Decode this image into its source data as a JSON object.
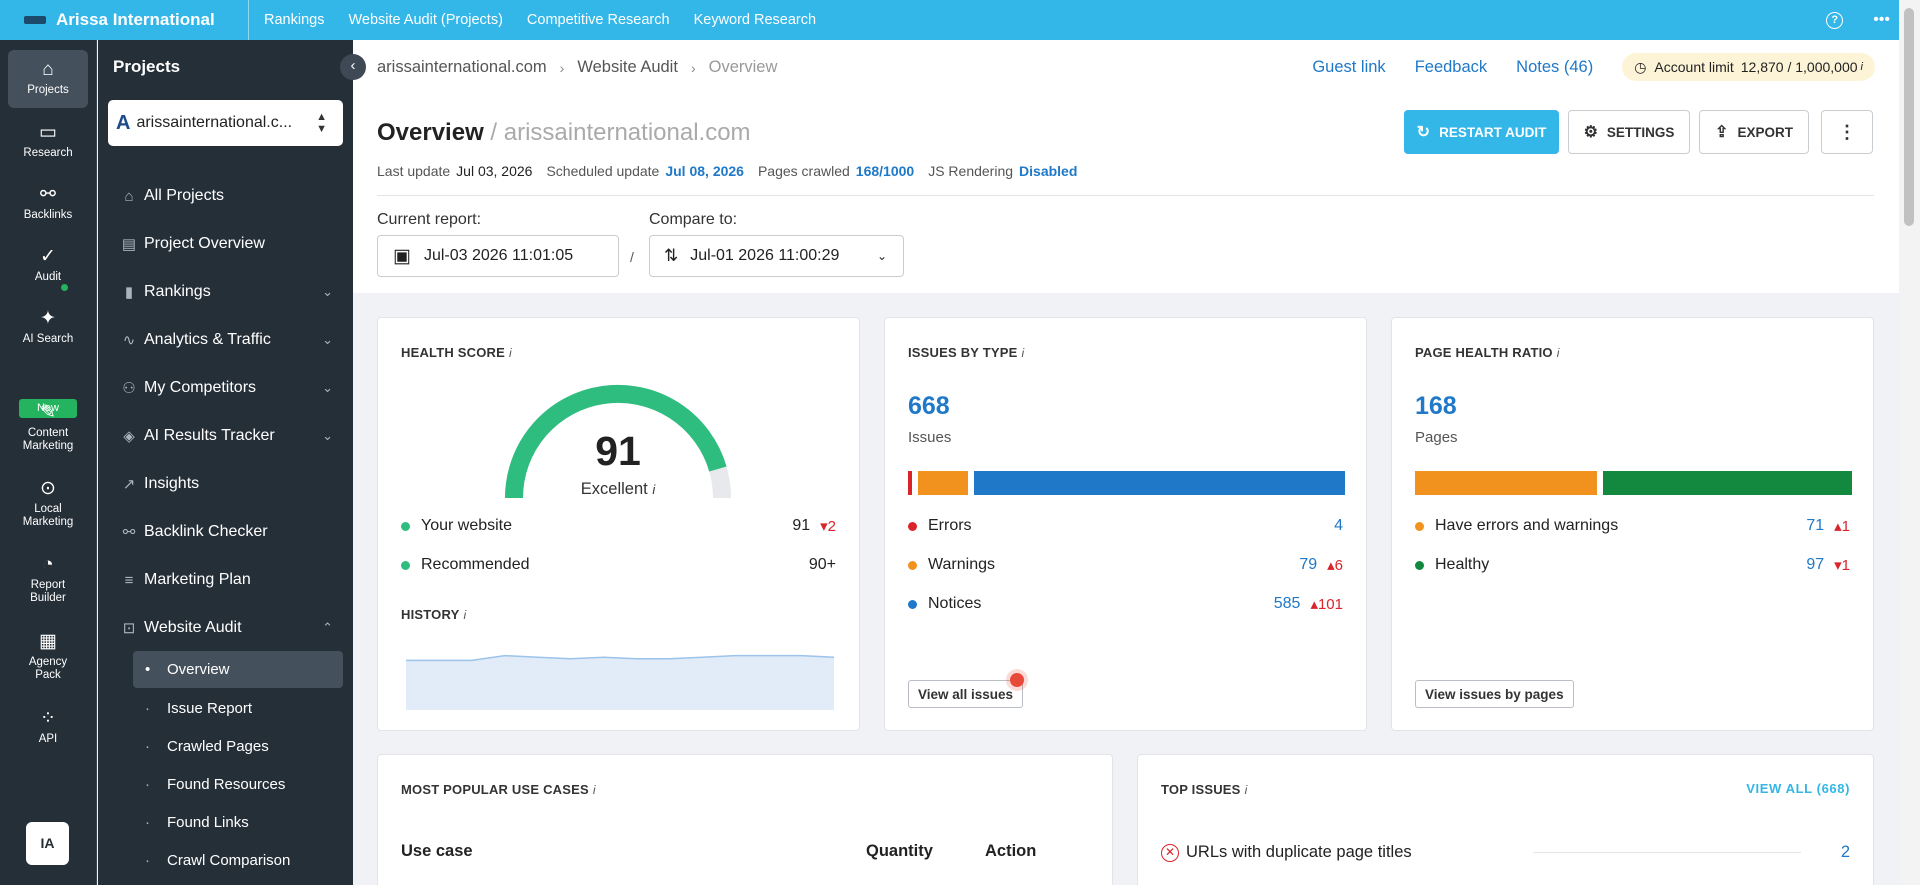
{
  "topbar": {
    "brand": "Arissa International",
    "nav": [
      "Rankings",
      "Website Audit (Projects)",
      "Competitive Research",
      "Keyword Research"
    ]
  },
  "rail": [
    {
      "label": "Projects",
      "icon": "home-icon"
    },
    {
      "label": "Research",
      "icon": "research-icon"
    },
    {
      "label": "Backlinks",
      "icon": "link-icon"
    },
    {
      "label": "Audit",
      "icon": "check-circle-icon"
    },
    {
      "label": "AI Search",
      "icon": "sparkle-icon",
      "badge": "New"
    },
    {
      "label": "Content Marketing",
      "icon": "edit-icon"
    },
    {
      "label": "Local Marketing",
      "icon": "pin-icon"
    },
    {
      "label": "Report Builder",
      "icon": "pie-icon"
    },
    {
      "label": "Agency Pack",
      "icon": "building-icon"
    },
    {
      "label": "API",
      "icon": "api-icon"
    }
  ],
  "user_initials": "IA",
  "sidebar": {
    "title": "Projects",
    "project": "arissainternational.c...",
    "items": [
      {
        "label": "All Projects",
        "icon": "home-icon"
      },
      {
        "label": "Project Overview",
        "icon": "grid-icon"
      },
      {
        "label": "Rankings",
        "icon": "bar-chart-icon"
      },
      {
        "label": "Analytics & Traffic",
        "icon": "pulse-icon"
      },
      {
        "label": "My Competitors",
        "icon": "users-icon"
      },
      {
        "label": "AI Results Tracker",
        "icon": "target-icon"
      },
      {
        "label": "Insights",
        "icon": "trend-icon"
      },
      {
        "label": "Backlink Checker",
        "icon": "link-icon"
      },
      {
        "label": "Marketing Plan",
        "icon": "checklist-icon"
      },
      {
        "label": "Website Audit",
        "icon": "audit-icon"
      }
    ],
    "subitems": [
      "Overview",
      "Issue Report",
      "Crawled Pages",
      "Found Resources",
      "Found Links",
      "Crawl Comparison"
    ]
  },
  "breadcrumb": [
    "arissainternational.com",
    "Website Audit",
    "Overview"
  ],
  "header_links": [
    "Guest link",
    "Feedback",
    "Notes (46)"
  ],
  "account": {
    "label": "Account limit",
    "value": "12,870 / 1,000,000"
  },
  "page_title": "Overview",
  "page_domain": "/ arissainternational.com",
  "meta": {
    "last_update_label": "Last update",
    "last_update": "Jul 03, 2026",
    "scheduled_label": "Scheduled update",
    "scheduled": "Jul 08, 2026",
    "pages_label": "Pages crawled",
    "pages": "168/1000",
    "js_label": "JS Rendering",
    "js": "Disabled"
  },
  "buttons": {
    "restart": "RESTART AUDIT",
    "settings": "SETTINGS",
    "export": "EXPORT"
  },
  "report": {
    "current_label": "Current report:",
    "current": "Jul-03 2026 11:01:05",
    "compare_label": "Compare to:",
    "compare": "Jul-01 2026 11:00:29",
    "sep": "/"
  },
  "health": {
    "title": "HEALTH SCORE",
    "score": "91",
    "score_value": 91,
    "rating": "Excellent",
    "website_label": "Your website",
    "website_value": "91",
    "website_delta": "2",
    "recommended_label": "Recommended",
    "recommended_value": "90+",
    "history_title": "HISTORY",
    "history": [
      91,
      91,
      91,
      94,
      93,
      92,
      93,
      92,
      92,
      93,
      94,
      94,
      94,
      93
    ]
  },
  "issues": {
    "title": "ISSUES BY TYPE",
    "total": "668",
    "total_label": "Issues",
    "rows": [
      {
        "label": "Errors",
        "value": "4",
        "delta": "",
        "color": "#d9242b"
      },
      {
        "label": "Warnings",
        "value": "79",
        "delta": "6",
        "color": "#f2921e"
      },
      {
        "label": "Notices",
        "value": "585",
        "delta": "101",
        "color": "#1f78c8"
      }
    ],
    "bar": [
      4,
      79,
      585
    ],
    "button": "View all issues"
  },
  "ratio": {
    "title": "PAGE HEALTH RATIO",
    "total": "168",
    "total_label": "Pages",
    "rows": [
      {
        "label": "Have errors and warnings",
        "value": "71",
        "delta": "1",
        "color": "#f2921e"
      },
      {
        "label": "Healthy",
        "value": "97",
        "delta": "1",
        "color": "#12893e"
      }
    ],
    "bar": [
      71,
      97
    ],
    "button": "View issues by pages"
  },
  "use_cases": {
    "title": "MOST POPULAR USE CASES",
    "col_use": "Use case",
    "col_qty": "Quantity",
    "col_action": "Action"
  },
  "top_issues": {
    "title": "TOP ISSUES",
    "view_all": "VIEW ALL (668)",
    "first_issue": "URLs with duplicate page titles",
    "first_count": "2"
  },
  "colors": {
    "accent": "#33b6e8",
    "link": "#1f78c8",
    "dark": "#252f38",
    "error": "#d9242b",
    "warning": "#f2921e",
    "healthy": "#12893e",
    "gauge": "#2ebd7e"
  }
}
